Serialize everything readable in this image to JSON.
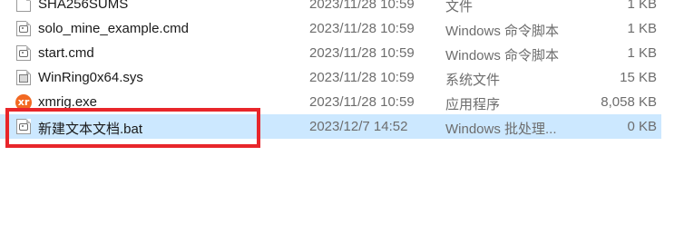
{
  "files": [
    {
      "name": "SHA256SUMS",
      "date": "2023/11/28 10:59",
      "type": "文件",
      "size": "1 KB",
      "icon": "file-icon"
    },
    {
      "name": "solo_mine_example.cmd",
      "date": "2023/11/28 10:59",
      "type": "Windows 命令脚本",
      "size": "1 KB",
      "icon": "cmd-file-icon"
    },
    {
      "name": "start.cmd",
      "date": "2023/11/28 10:59",
      "type": "Windows 命令脚本",
      "size": "1 KB",
      "icon": "cmd-file-icon"
    },
    {
      "name": "WinRing0x64.sys",
      "date": "2023/11/28 10:59",
      "type": "系统文件",
      "size": "15 KB",
      "icon": "system-file-icon"
    },
    {
      "name": "xmrig.exe",
      "date": "2023/11/28 10:59",
      "type": "应用程序",
      "size": "8,058 KB",
      "icon": "xmrig-app-icon"
    },
    {
      "name": "新建文本文档.bat",
      "date": "2023/12/7 14:52",
      "type": "Windows 批处理...",
      "size": "0 KB",
      "icon": "bat-file-icon"
    }
  ],
  "selected_index": 5,
  "icon_glyphs": {
    "xmrig_logo": "xr"
  },
  "colors": {
    "selection": "#cce8ff",
    "highlight_border": "#e8262b",
    "xmrig_icon": "#f26822",
    "secondary_text": "#6d6d6d"
  }
}
